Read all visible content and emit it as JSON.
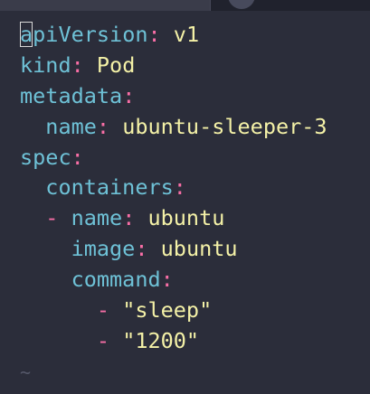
{
  "editor": {
    "lines": [
      {
        "indent": "",
        "key_first": "a",
        "key_rest": "piVersion",
        "colon": ":",
        "value": " v1"
      },
      {
        "indent": "",
        "key": "kind",
        "colon": ":",
        "value": " Pod"
      },
      {
        "indent": "",
        "key": "metadata",
        "colon": ":"
      },
      {
        "indent": "  ",
        "key": "name",
        "colon": ":",
        "value": " ubuntu-sleeper-3"
      },
      {
        "indent": "",
        "key": "spec",
        "colon": ":"
      },
      {
        "indent": "  ",
        "key": "containers",
        "colon": ":"
      },
      {
        "indent": "  ",
        "dash": "- ",
        "key": "name",
        "colon": ":",
        "value": " ubuntu"
      },
      {
        "indent": "    ",
        "key": "image",
        "colon": ":",
        "value": " ubuntu"
      },
      {
        "indent": "    ",
        "key": "command",
        "colon": ":"
      },
      {
        "indent": "      ",
        "dash": "- ",
        "value": "\"sleep\""
      },
      {
        "indent": "      ",
        "dash": "- ",
        "value": "\"1200\""
      }
    ],
    "empty_line_marker": "~"
  },
  "colors": {
    "background": "#2b2d3a",
    "key": "#6ec1d6",
    "punctuation": "#f96ea6",
    "value": "#f4f1a7"
  }
}
